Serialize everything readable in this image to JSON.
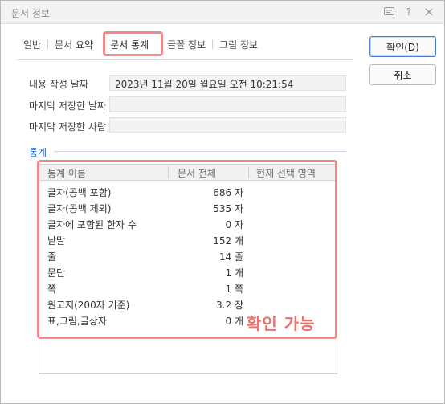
{
  "window": {
    "title": "문서 정보"
  },
  "tabs": [
    {
      "label": "일반"
    },
    {
      "label": "문서 요약"
    },
    {
      "label": "문서 통계"
    },
    {
      "label": "글꼴 정보"
    },
    {
      "label": "그림 정보"
    }
  ],
  "buttons": {
    "ok": "확인(D)",
    "cancel": "취소"
  },
  "info": {
    "created_label": "내용 작성 날짜",
    "created_value": "2023년 11월 20일 월요일 오전 10:21:54",
    "last_saved_label": "마지막 저장한 날짜",
    "last_saved_value": "",
    "last_saver_label": "마지막 저장한 사람",
    "last_saver_value": ""
  },
  "stats": {
    "section_title": "통계",
    "columns": [
      "통계 이름",
      "문서 전체",
      "현재 선택 영역"
    ],
    "rows": [
      {
        "name": "글자(공백 포함)",
        "value": "686 자"
      },
      {
        "name": "글자(공백 제외)",
        "value": "535 자"
      },
      {
        "name": "글자에 포함된 한자 수",
        "value": "0 자"
      },
      {
        "name": "낱말",
        "value": "152 개"
      },
      {
        "name": "줄",
        "value": "14 줄"
      },
      {
        "name": "문단",
        "value": "1 개"
      },
      {
        "name": "쪽",
        "value": "1 쪽"
      },
      {
        "name": "원고지(200자 기준)",
        "value": "3.2 장"
      },
      {
        "name": "표,그림,글상자",
        "value": "0 개"
      }
    ]
  },
  "annotation": {
    "callout": "확인 가능",
    "highlight_color": "#f08a8a"
  },
  "icons": [
    "help-icon",
    "question-icon",
    "close-icon"
  ]
}
